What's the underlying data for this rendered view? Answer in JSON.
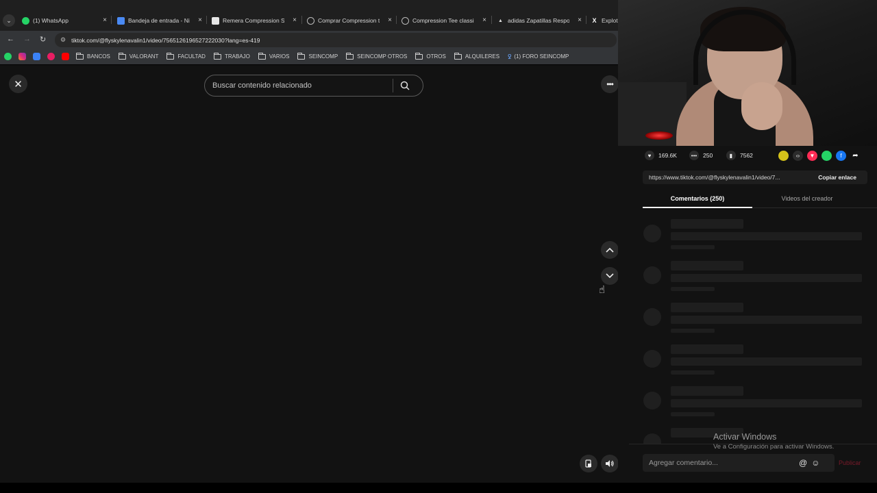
{
  "browser": {
    "tabs": [
      {
        "label": "(1) WhatsApp",
        "color": "#25d366",
        "icon": "whatsapp-icon"
      },
      {
        "label": "Bandeja de entrada - Nic",
        "color": "#4a8af4",
        "icon": "mail-icon"
      },
      {
        "label": "Remera Compression Sh",
        "color": "#2a2a2a",
        "icon": "store-icon"
      },
      {
        "label": "Comprar Compression te",
        "color": "#6f6f6f",
        "icon": "globe-icon"
      },
      {
        "label": "Compression Tee classic",
        "color": "#6f6f6f",
        "icon": "globe-icon"
      },
      {
        "label": "adidas Zapatillas Respon",
        "color": "#1f1f1f",
        "icon": "adidas-icon"
      },
      {
        "label": "Explot",
        "color": "#1f1f1f",
        "icon": "x-icon"
      }
    ],
    "tab_close": "×",
    "url": "tiktok.com/@flyskylenavalin1/video/7565126196527222030?lang=es-419",
    "bookmarks": [
      {
        "label": "BANCOS"
      },
      {
        "label": "VALORANT"
      },
      {
        "label": "FACULTAD"
      },
      {
        "label": "TRABAJO"
      },
      {
        "label": "VARIOS"
      },
      {
        "label": "SEINCOMP"
      },
      {
        "label": "SEINCOMP OTROS"
      },
      {
        "label": "OTROS"
      },
      {
        "label": "ALQUILERES"
      },
      {
        "label": "(1) FORO SEINCOMP"
      }
    ]
  },
  "viewer": {
    "close_glyph": "✕",
    "search_placeholder": "Buscar contenido relacionado",
    "more_glyph": "•••"
  },
  "panel": {
    "stats": {
      "likes": "169.6K",
      "comments": "250",
      "saves": "7562"
    },
    "link_url": "https://www.tiktok.com/@flyskylenavalin1/video/7...",
    "copy_label": "Copiar enlace",
    "tabs": {
      "comments": "Comentarios (250)",
      "creator_videos": "Videos del creador"
    },
    "comment_placeholder": "Agregar comentario...",
    "publish_label": "Publicar"
  },
  "watermark": {
    "title": "Activar Windows",
    "subtitle": "Ve a Configuración para activar Windows."
  },
  "colors": {
    "accent_tiktok": "#fe2c55",
    "background": "#121212"
  }
}
